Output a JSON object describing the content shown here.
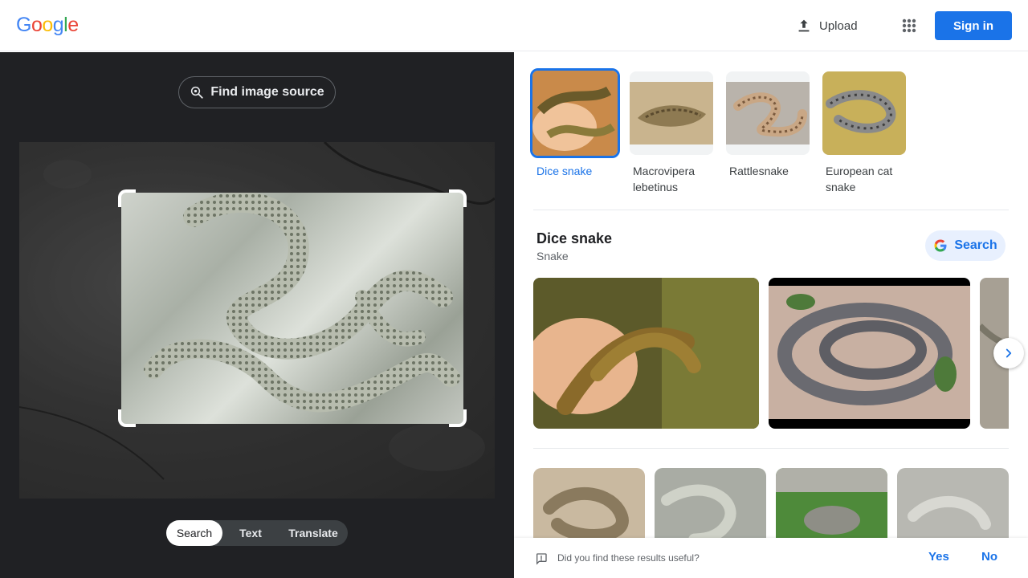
{
  "header": {
    "logo_letters": [
      "G",
      "o",
      "o",
      "g",
      "l",
      "e"
    ],
    "logo_colors": [
      "#4285f4",
      "#ea4335",
      "#fbbc05",
      "#4285f4",
      "#34a853",
      "#ea4335"
    ],
    "upload_label": "Upload",
    "upload_icon": "upload-icon",
    "apps_icon": "apps-grid-icon",
    "signin_label": "Sign in"
  },
  "left": {
    "find_source_label": "Find image source",
    "find_source_icon": "lens-search-icon",
    "mode_tabs": [
      {
        "label": "Search",
        "active": true
      },
      {
        "label": "Text",
        "active": false
      },
      {
        "label": "Translate",
        "active": false
      }
    ]
  },
  "right": {
    "entities": [
      {
        "label": "Dice snake",
        "selected": true
      },
      {
        "label": "Macrovipera lebetinus",
        "selected": false
      },
      {
        "label": "Rattlesnake",
        "selected": false
      },
      {
        "label": "European cat snake",
        "selected": false
      }
    ],
    "knowledge": {
      "title": "Dice snake",
      "subtitle": "Snake",
      "search_label": "Search",
      "search_icon": "google-g-icon"
    },
    "next_icon": "chevron-right-icon",
    "feedback": {
      "question": "Did you find these results useful?",
      "yes_label": "Yes",
      "no_label": "No",
      "icon": "feedback-icon"
    }
  },
  "colors": {
    "accent": "#1a73e8",
    "left_bg": "#202124"
  }
}
